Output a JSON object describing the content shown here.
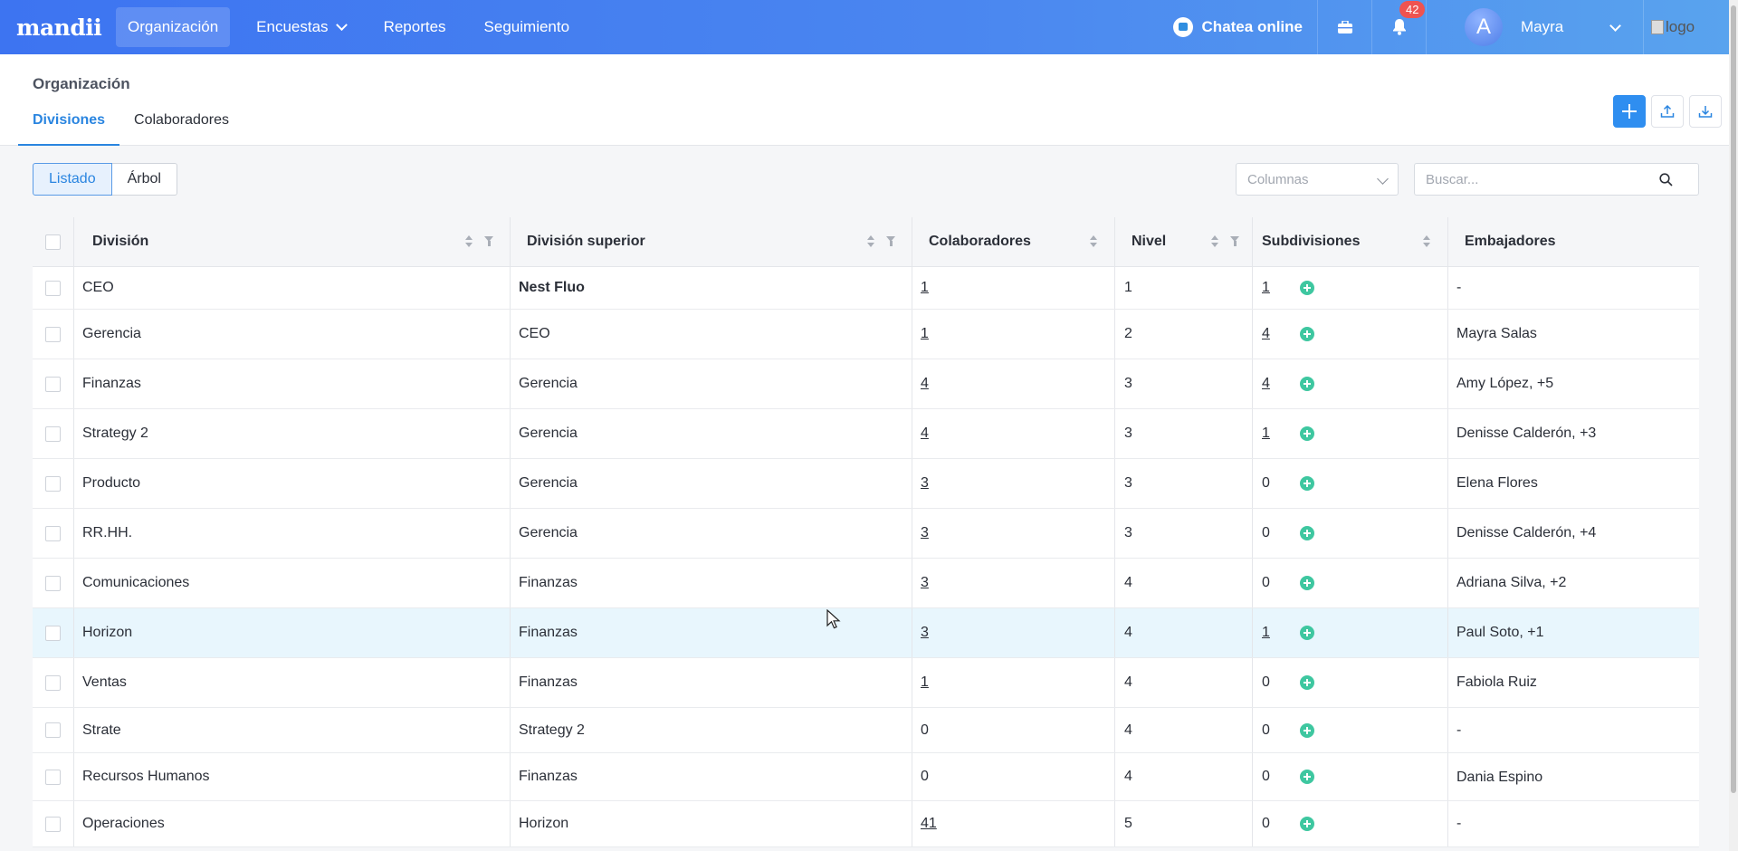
{
  "nav": {
    "logo": "mandii",
    "items": [
      {
        "label": "Organización",
        "active": true
      },
      {
        "label": "Encuestas",
        "dropdown": true
      },
      {
        "label": "Reportes"
      },
      {
        "label": "Seguimiento"
      }
    ],
    "chat_label": "Chatea online",
    "notification_count": "42",
    "avatar_initial": "A",
    "user_name": "Mayra",
    "logo_alt": "logo"
  },
  "header": {
    "title": "Organización",
    "tabs": [
      {
        "label": "Divisiones",
        "active": true
      },
      {
        "label": "Colaboradores"
      }
    ]
  },
  "toolbar": {
    "view_listado": "Listado",
    "view_arbol": "Árbol",
    "columns_placeholder": "Columnas",
    "search_placeholder": "Buscar..."
  },
  "table": {
    "headers": [
      "División",
      "División superior",
      "Colaboradores",
      "Nivel",
      "Subdivisiones",
      "Embajadores"
    ],
    "rows": [
      {
        "division": "CEO",
        "superior": "Nest Fluo",
        "superior_bold": true,
        "colaboradores": "1",
        "col_link": true,
        "nivel": "1",
        "subdivisiones": "1",
        "sub_link": true,
        "embajadores": "-"
      },
      {
        "division": "Gerencia",
        "superior": "CEO",
        "colaboradores": "1",
        "col_link": true,
        "nivel": "2",
        "subdivisiones": "4",
        "sub_link": true,
        "embajadores": "Mayra Salas"
      },
      {
        "division": "Finanzas",
        "superior": "Gerencia",
        "colaboradores": "4",
        "col_link": true,
        "nivel": "3",
        "subdivisiones": "4",
        "sub_link": true,
        "embajadores": "Amy López, +5"
      },
      {
        "division": "Strategy 2",
        "superior": "Gerencia",
        "colaboradores": "4",
        "col_link": true,
        "nivel": "3",
        "subdivisiones": "1",
        "sub_link": true,
        "embajadores": "Denisse Calderón, +3"
      },
      {
        "division": "Producto",
        "superior": "Gerencia",
        "colaboradores": "3",
        "col_link": true,
        "nivel": "3",
        "subdivisiones": "0",
        "embajadores": "Elena Flores"
      },
      {
        "division": "RR.HH.",
        "superior": "Gerencia",
        "colaboradores": "3",
        "col_link": true,
        "nivel": "3",
        "subdivisiones": "0",
        "embajadores": "Denisse Calderón, +4"
      },
      {
        "division": "Comunicaciones",
        "superior": "Finanzas",
        "colaboradores": "3",
        "col_link": true,
        "nivel": "4",
        "subdivisiones": "0",
        "embajadores": "Adriana Silva, +2"
      },
      {
        "division": "Horizon",
        "superior": "Finanzas",
        "colaboradores": "3",
        "col_link": true,
        "nivel": "4",
        "subdivisiones": "1",
        "sub_link": true,
        "embajadores": "Paul Soto, +1",
        "highlight": true
      },
      {
        "division": "Ventas",
        "superior": "Finanzas",
        "colaboradores": "1",
        "col_link": true,
        "nivel": "4",
        "subdivisiones": "0",
        "embajadores": "Fabiola Ruiz"
      },
      {
        "division": "Strate",
        "superior": "Strategy 2",
        "colaboradores": "0",
        "nivel": "4",
        "subdivisiones": "0",
        "embajadores": "-"
      },
      {
        "division": "Recursos Humanos",
        "superior": "Finanzas",
        "colaboradores": "0",
        "nivel": "4",
        "subdivisiones": "0",
        "embajadores": "Dania Espino"
      },
      {
        "division": "Operaciones",
        "superior": "Horizon",
        "colaboradores": "41",
        "col_link": true,
        "nivel": "5",
        "subdivisiones": "0",
        "embajadores": "-"
      }
    ]
  },
  "colors": {
    "nav_start": "#3d74f1",
    "nav_end": "#59a3ee",
    "accent": "#2a85e0",
    "add_green": "#3ec7a0",
    "badge_red": "#ef5350",
    "row_highlight": "#e8f6fd"
  }
}
